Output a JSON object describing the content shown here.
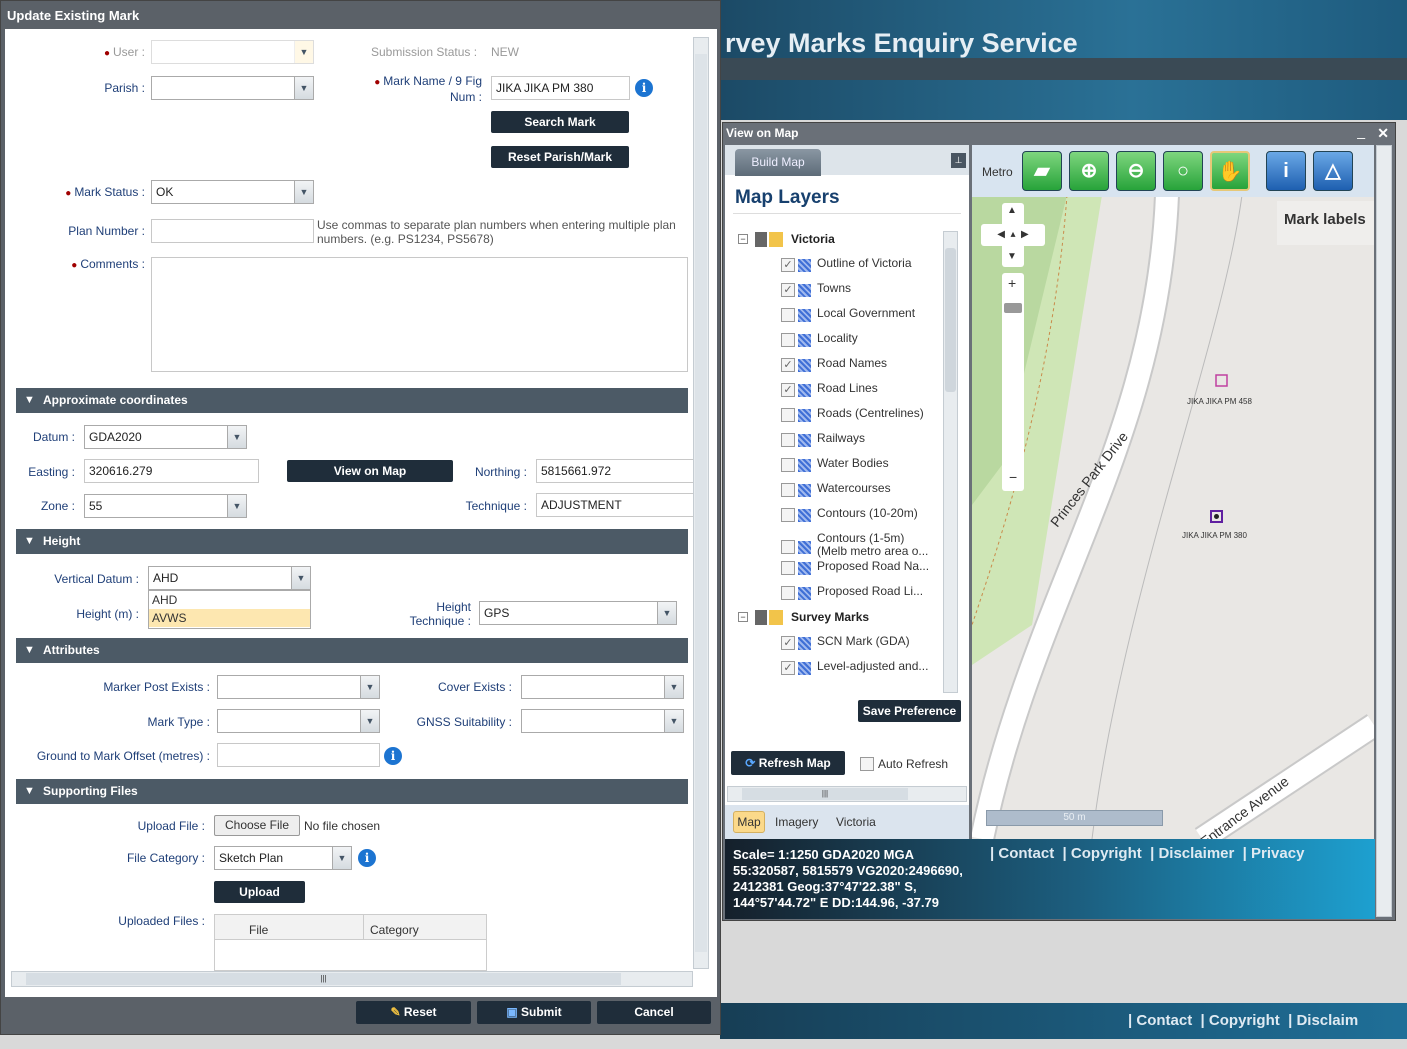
{
  "background": {
    "title": "rvey Marks Enquiry Service",
    "footer_links": [
      "Contact",
      "Copyright",
      "Disclaim"
    ]
  },
  "dialog": {
    "title": "Update Existing Mark",
    "user_label": "User :",
    "user_value": "",
    "submission_status_label": "Submission Status :",
    "submission_status_value": "NEW",
    "parish_label": "Parish :",
    "parish_value": "",
    "mark_name_label_1": "Mark Name / 9 Fig",
    "mark_name_label_2": "Num :",
    "mark_name_value": "JIKA JIKA PM  380",
    "search_mark": "Search Mark",
    "reset_parish_mark": "Reset Parish/Mark",
    "mark_status_label": "Mark Status :",
    "mark_status_value": "OK",
    "plan_number_label": "Plan Number :",
    "plan_number_value": "",
    "plan_hint": "Use commas to separate plan numbers when entering multiple plan numbers. (e.g. PS1234, PS5678)",
    "comments_label": "Comments :",
    "comments_value": "",
    "approx": {
      "title": "Approximate coordinates",
      "datum_label": "Datum :",
      "datum_value": "GDA2020",
      "easting_label": "Easting :",
      "easting_value": "320616.279",
      "view_on_map": "View on Map",
      "northing_label": "Northing :",
      "northing_value": "5815661.972",
      "zone_label": "Zone :",
      "zone_value": "55",
      "technique_label": "Technique :",
      "technique_value": "ADJUSTMENT"
    },
    "height": {
      "title": "Height",
      "vertical_datum_label": "Vertical Datum :",
      "vertical_datum_value": "AHD",
      "options": [
        "AHD",
        "AVWS"
      ],
      "highlighted_option": "AVWS",
      "height_label": "Height (m) :",
      "height_technique_label_1": "Height",
      "height_technique_label_2": "Technique :",
      "height_technique_value": "GPS"
    },
    "attributes": {
      "title": "Attributes",
      "marker_post_label": "Marker Post Exists :",
      "cover_label": "Cover Exists :",
      "mark_type_label": "Mark Type :",
      "gnss_label": "GNSS Suitability :",
      "offset_label": "Ground to Mark Offset (metres) :"
    },
    "files": {
      "title": "Supporting Files",
      "upload_file_label": "Upload File :",
      "choose_file": "Choose File",
      "no_file": "No file chosen",
      "file_category_label": "File Category :",
      "file_category_value": "Sketch Plan",
      "upload": "Upload",
      "uploaded_files_label": "Uploaded Files :",
      "columns": [
        "File",
        "Category"
      ]
    },
    "buttons": {
      "reset": "Reset",
      "submit": "Submit",
      "cancel": "Cancel"
    }
  },
  "map_window": {
    "title": "View on Map",
    "tab": "Build Map",
    "layers_title": "Map Layers",
    "groups": [
      {
        "name": "Victoria",
        "layers": [
          {
            "name": "Outline of Victoria",
            "checked": true
          },
          {
            "name": "Towns",
            "checked": true
          },
          {
            "name": "Local Government",
            "checked": false
          },
          {
            "name": "Locality",
            "checked": false
          },
          {
            "name": "Road Names",
            "checked": true
          },
          {
            "name": "Road Lines",
            "checked": true
          },
          {
            "name": "Roads (Centrelines)",
            "checked": false
          },
          {
            "name": "Railways",
            "checked": false
          },
          {
            "name": "Water Bodies",
            "checked": false
          },
          {
            "name": "Watercourses",
            "checked": false
          },
          {
            "name": "Contours (10-20m)",
            "checked": false
          },
          {
            "name": "Contours (1-5m)",
            "name2": "(Melb metro area o...",
            "checked": false
          },
          {
            "name": "Proposed Road Na...",
            "checked": false
          },
          {
            "name": "Proposed Road Li...",
            "checked": false
          }
        ]
      },
      {
        "name": "Survey Marks",
        "layers": [
          {
            "name": "SCN Mark (GDA)",
            "checked": true
          },
          {
            "name": "Level-adjusted and...",
            "checked": true
          }
        ]
      }
    ],
    "save_preference": "Save Preference",
    "refresh_map": "Refresh Map",
    "auto_refresh": "Auto Refresh",
    "auto_refresh_checked": false,
    "basemaps": [
      "Map",
      "Imagery",
      "Victoria"
    ],
    "active_basemap": "Map",
    "toolbar_label": "Metro",
    "tools": [
      "victoria-extent",
      "zoom-in",
      "zoom-out",
      "zoom-extent",
      "pan",
      "identify",
      "mark-info"
    ],
    "active_tool": "pan",
    "mark_labels": "Mark labels",
    "marks": [
      "JIKA JIKA PM 458",
      "JIKA JIKA PM 380"
    ],
    "roads": [
      "Princes Park Drive",
      "Entrance Avenue"
    ],
    "scale_bar": "50 m",
    "status_lines": [
      "Scale= 1:1250 GDA2020 MGA",
      "55:320587, 5815579 VG2020:2496690,",
      "2412381 Geog:37°47'22.38\" S,",
      "144°57'44.72\" E DD:144.96, -37.79"
    ],
    "links": [
      "Contact",
      "Copyright",
      "Disclaimer",
      "Privacy"
    ]
  }
}
